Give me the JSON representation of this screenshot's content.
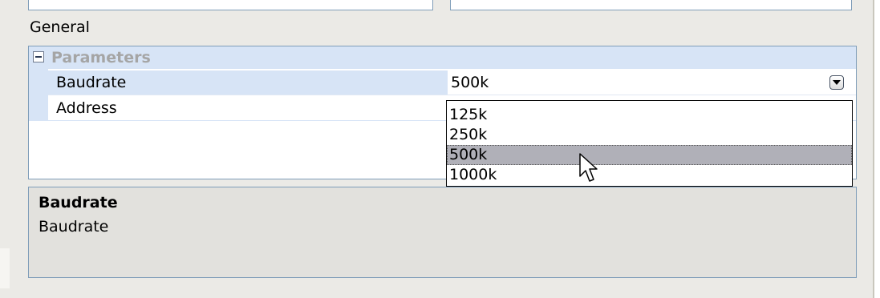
{
  "section": {
    "label": "General"
  },
  "grid": {
    "category": {
      "label": "Parameters",
      "icon": "collapse-icon"
    },
    "properties": [
      {
        "name": "Baudrate",
        "value": "500k"
      },
      {
        "name": "Address",
        "value": ""
      }
    ]
  },
  "dropdown": {
    "options": [
      "125k",
      "250k",
      "500k",
      "1000k"
    ],
    "selected": "500k"
  },
  "help": {
    "title": "Baudrate",
    "description": "Baudrate"
  },
  "colors": {
    "selection_bg": "#d7e4f6",
    "border": "#7f9db9",
    "highlight": "#b0b0b8",
    "panel": "#ebeae6"
  }
}
